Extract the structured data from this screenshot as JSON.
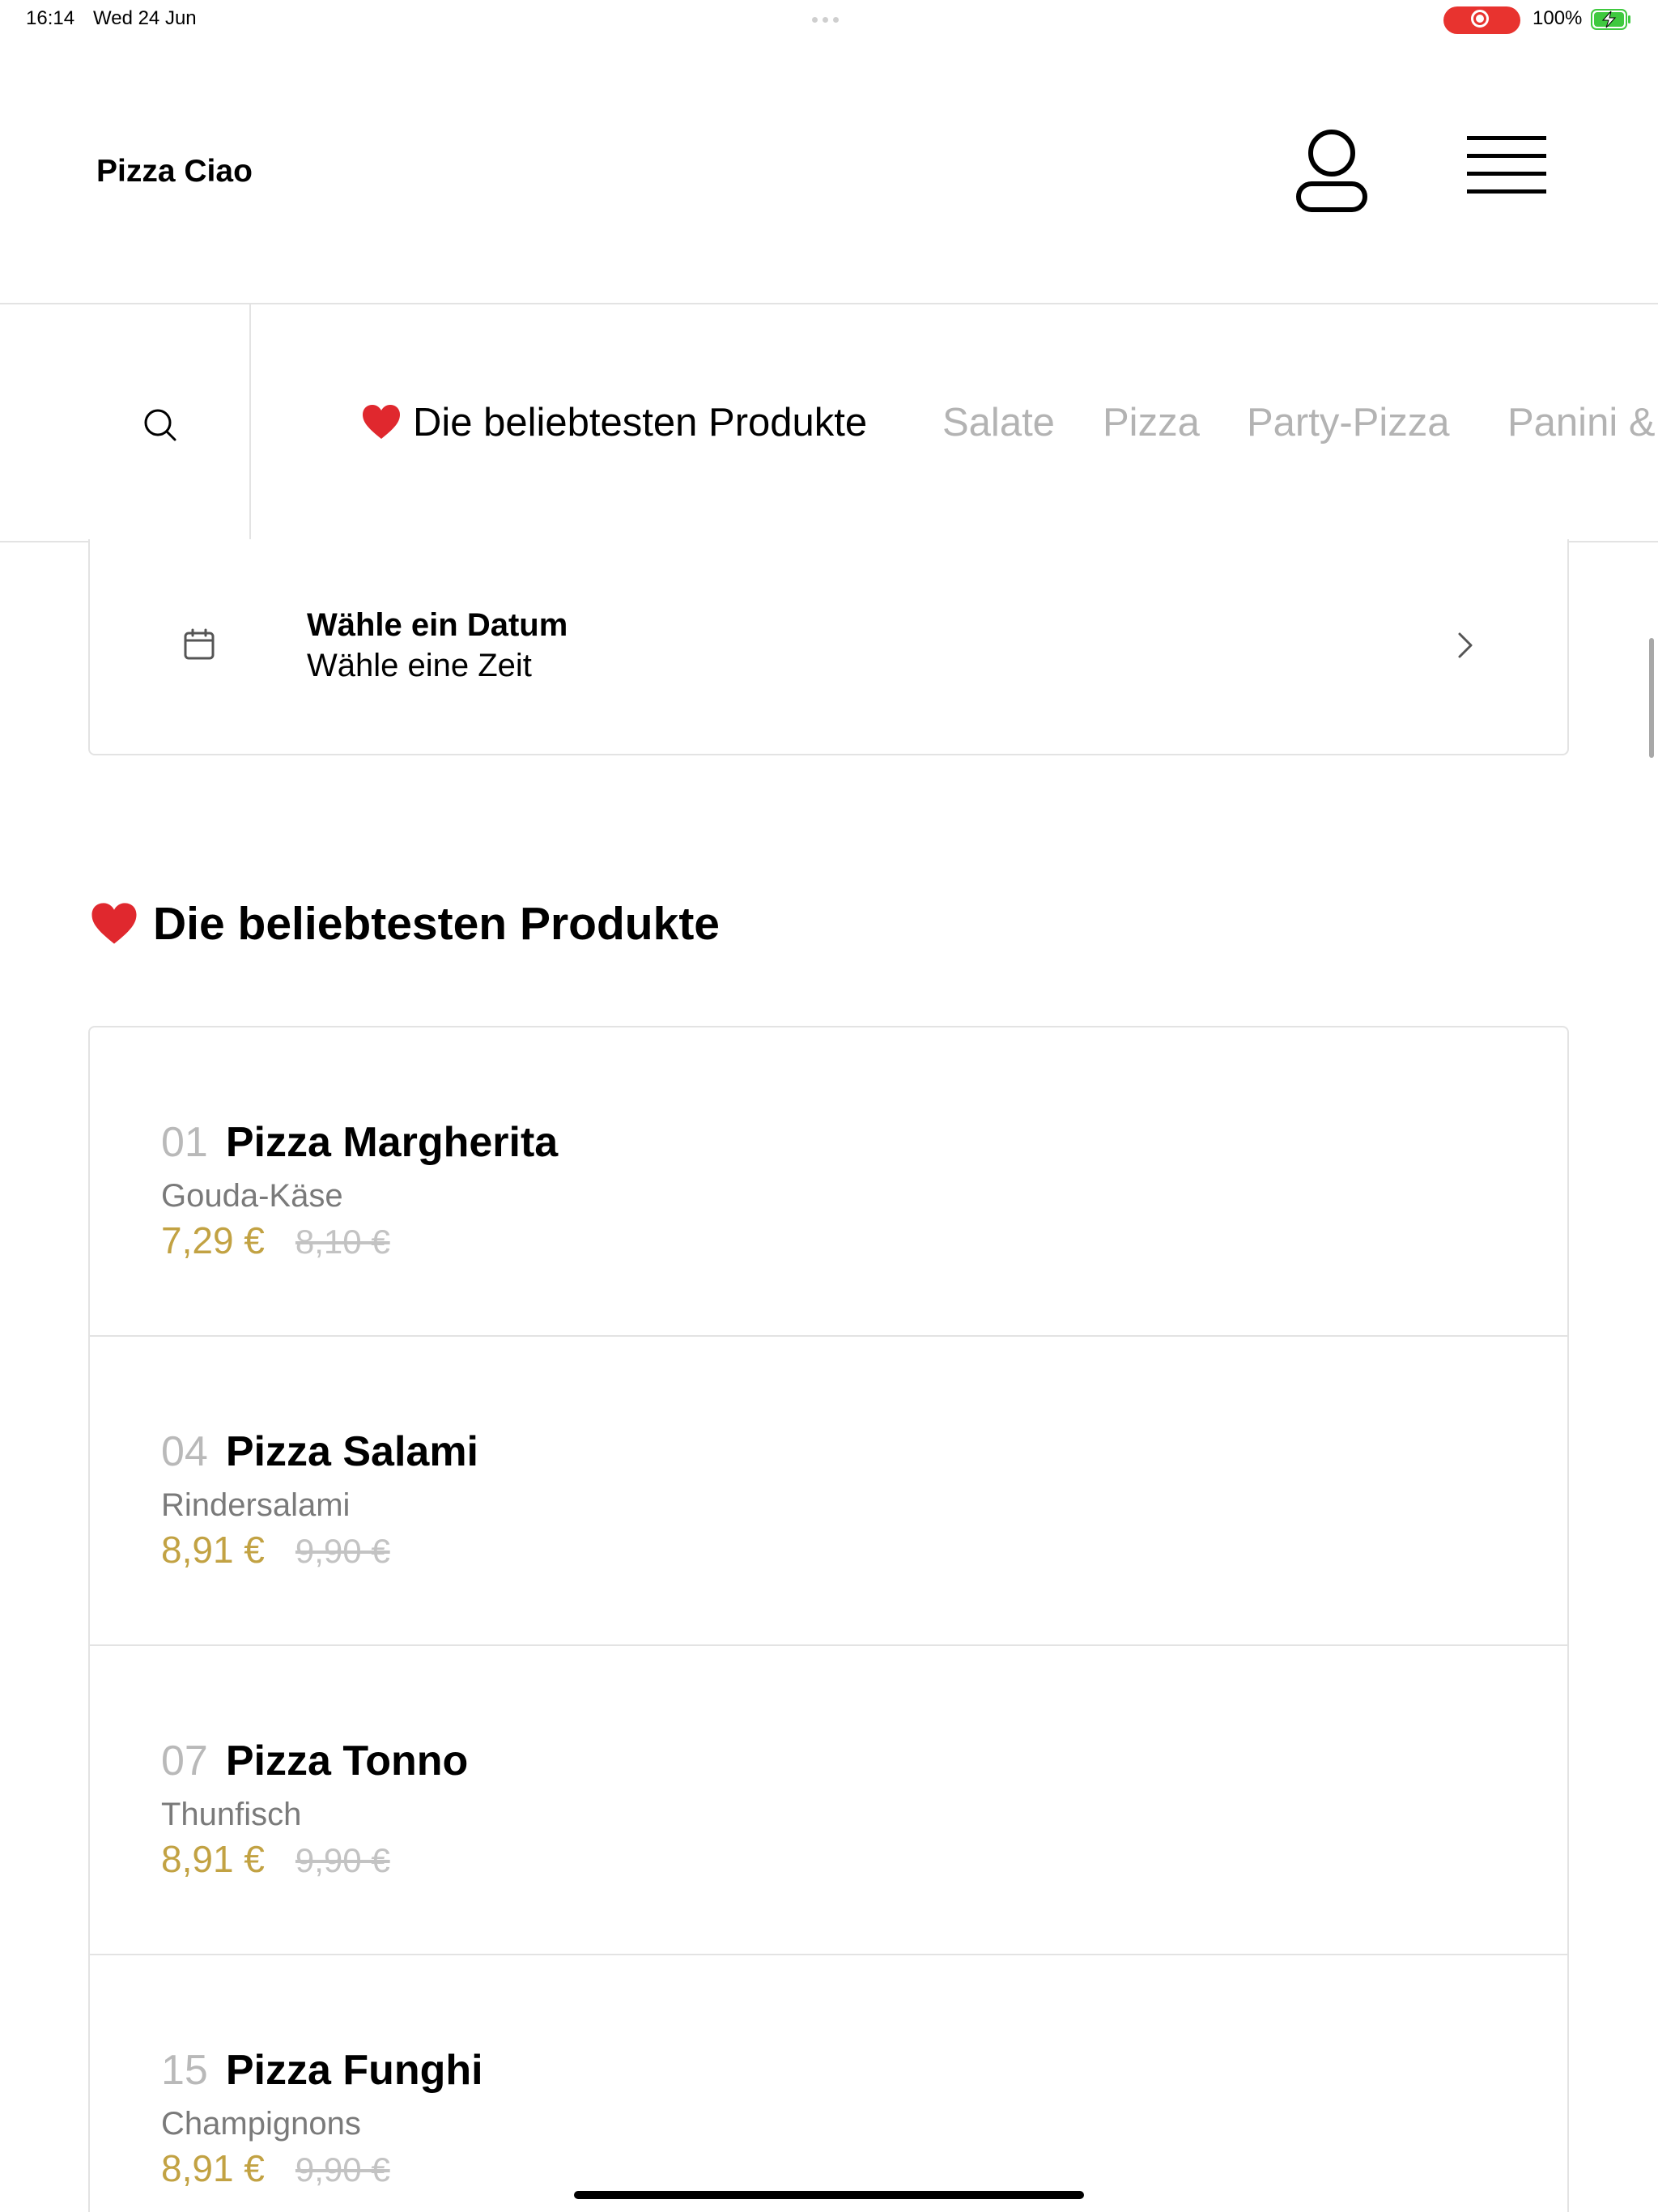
{
  "status_bar": {
    "time": "16:14",
    "date": "Wed 24 Jun",
    "battery": "100%"
  },
  "header": {
    "title": "Pizza Ciao"
  },
  "categories": {
    "tabs": [
      {
        "label": "Die beliebtesten Produkte",
        "active": true
      },
      {
        "label": "Salate"
      },
      {
        "label": "Pizza"
      },
      {
        "label": "Party-Pizza"
      },
      {
        "label": "Panini &"
      }
    ]
  },
  "schedule": {
    "title": "Wähle ein Datum",
    "subtitle": "Wähle eine Zeit"
  },
  "section": {
    "title": "Die beliebtesten Produkte"
  },
  "products": [
    {
      "number": "01",
      "name": "Pizza Margherita",
      "description": "Gouda-Käse",
      "price": "7,29 €",
      "old_price": "8,10 €"
    },
    {
      "number": "04",
      "name": "Pizza Salami",
      "description": "Rindersalami",
      "price": "8,91 €",
      "old_price": "9,90 €"
    },
    {
      "number": "07",
      "name": "Pizza Tonno",
      "description": "Thunfisch",
      "price": "8,91 €",
      "old_price": "9,90 €"
    },
    {
      "number": "15",
      "name": "Pizza Funghi",
      "description": "Champignons",
      "price": "8,91 €",
      "old_price": "9,90 €"
    }
  ],
  "colors": {
    "price": "#c2a243",
    "record": "#e8332f",
    "battery": "#3fc93f",
    "heart": "#e0282e"
  }
}
